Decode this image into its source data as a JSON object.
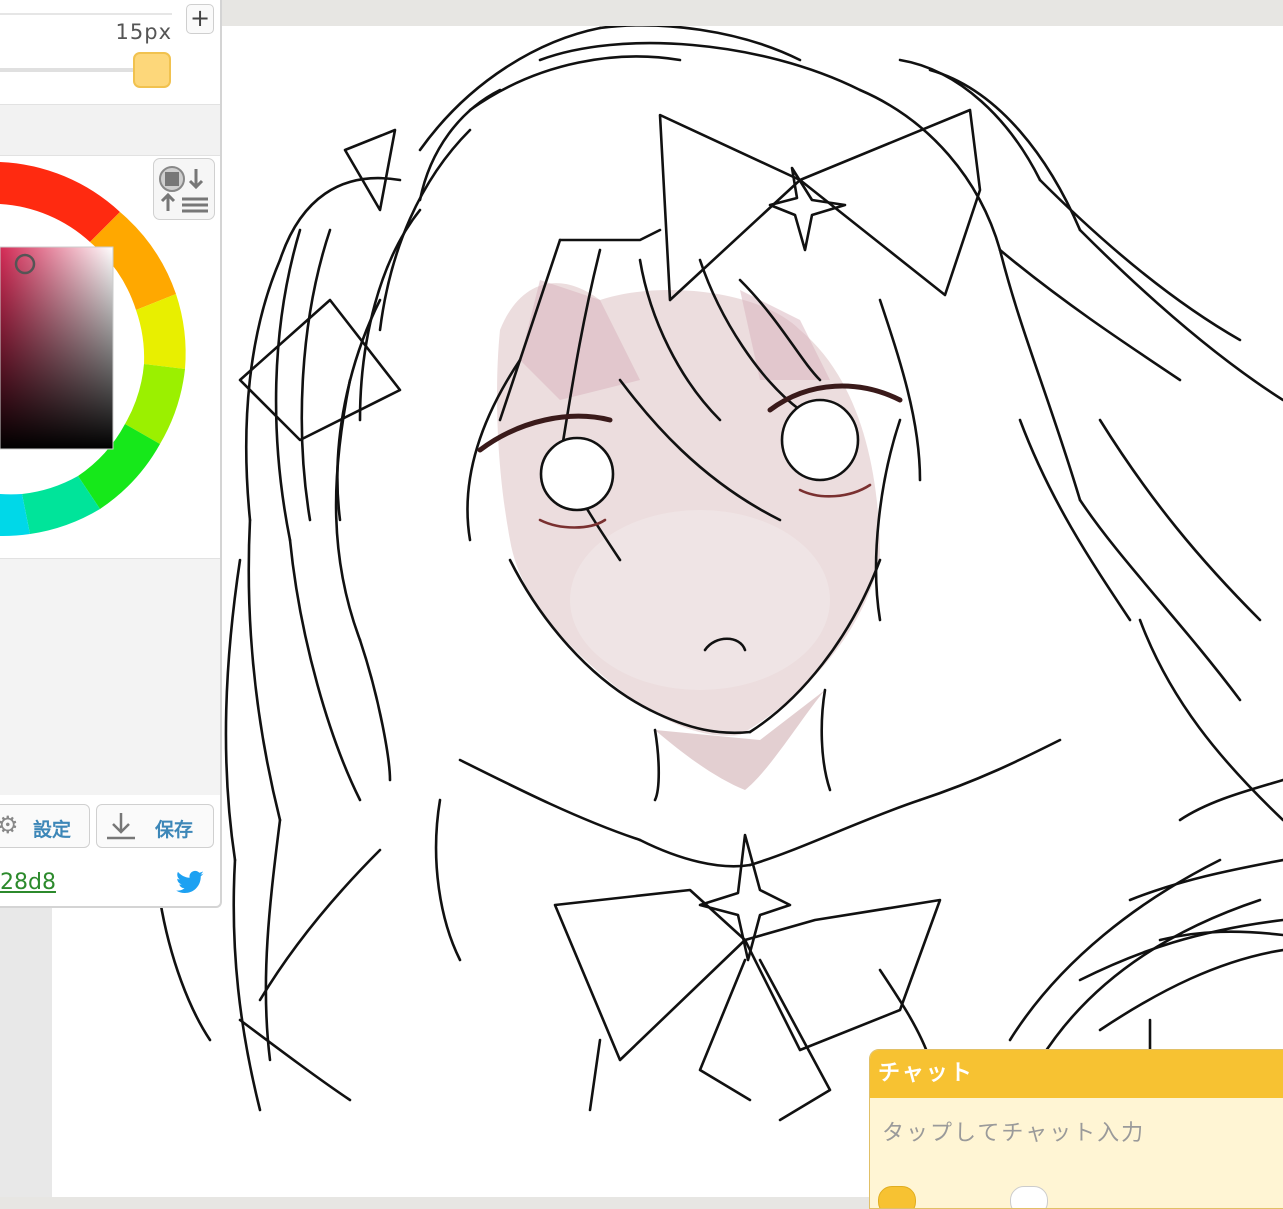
{
  "toolbar": {
    "brush_size": "15px",
    "plus_label": "+",
    "settings_label": "設定",
    "save_label": "保存",
    "room_code_fragment": "28d8",
    "brush_size_color": "#fdd77a",
    "accent_color": "#3d87b8",
    "icons": [
      "plus-icon",
      "color-mode-icon",
      "gear-icon",
      "download-icon",
      "twitter-icon"
    ]
  },
  "color_picker": {
    "type": "hue-ring-with-sv-square",
    "selected_hue_color": "#d42a55"
  },
  "chat": {
    "title": "チャット",
    "input_placeholder": "タップしてチャット入力",
    "header_color": "#f7c232",
    "tabs": [
      "",
      ""
    ]
  },
  "canvas": {
    "background": "#ffffff",
    "content": "line-art"
  }
}
